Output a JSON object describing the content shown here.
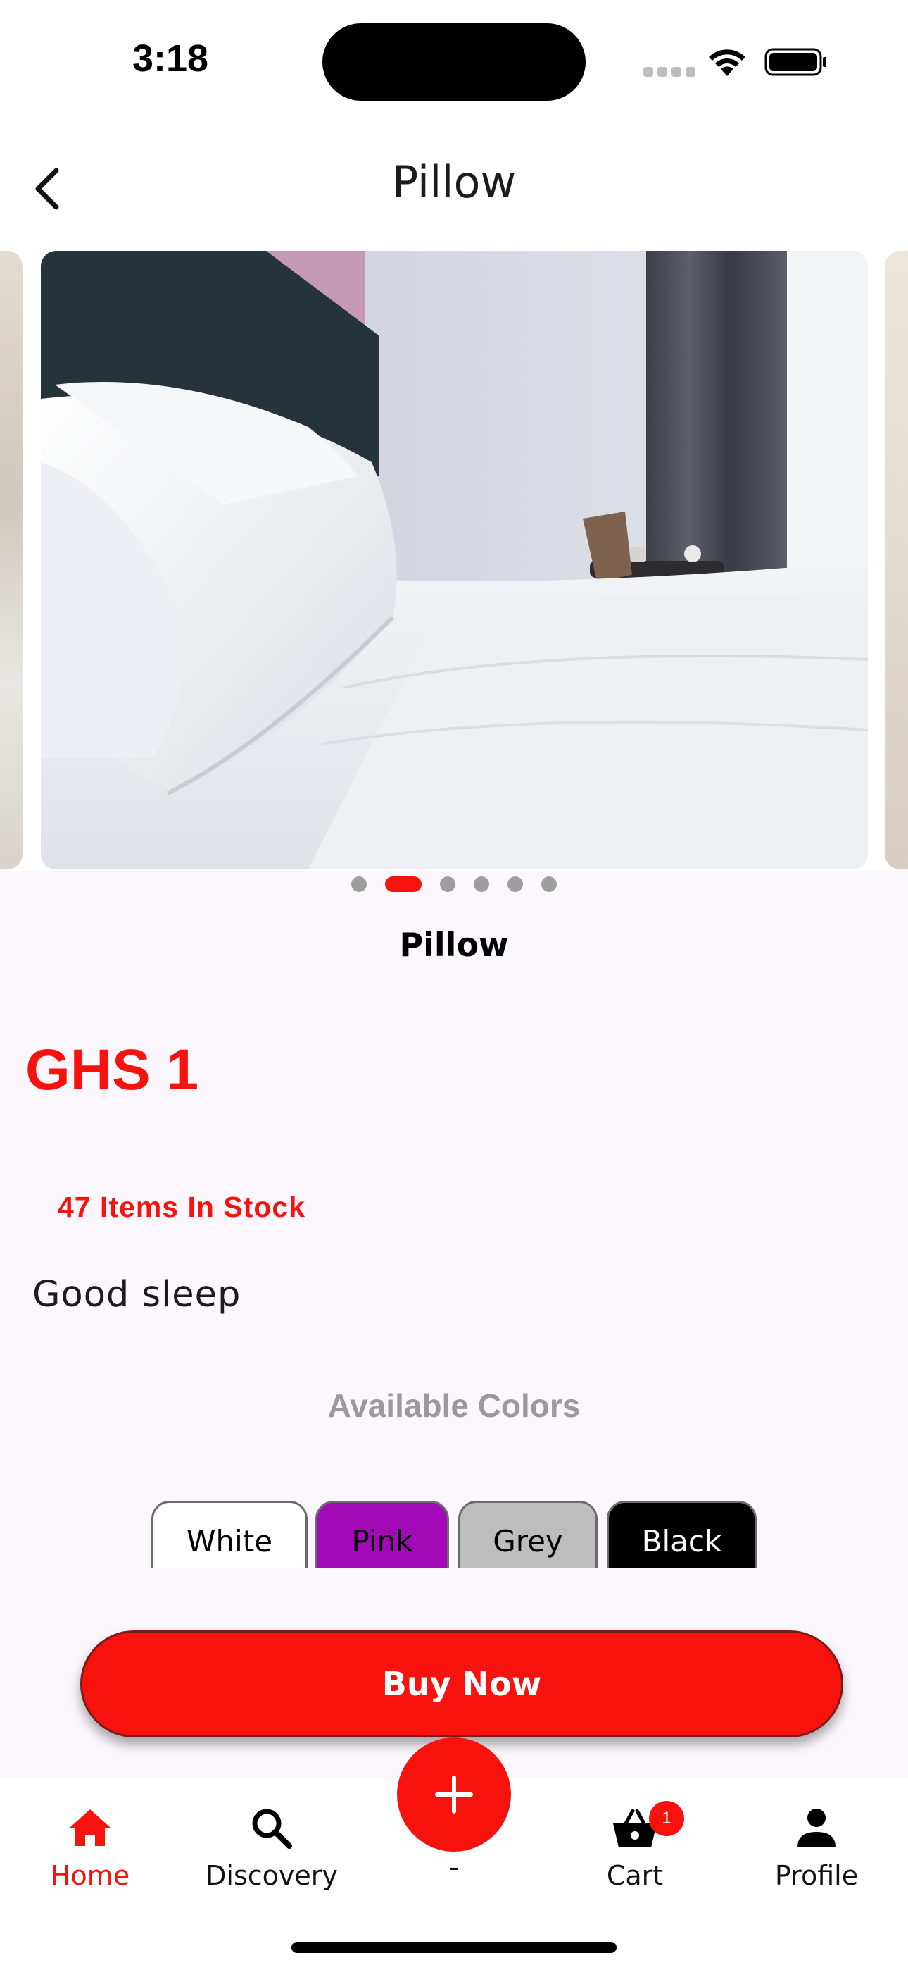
{
  "status_bar": {
    "time": "3:18"
  },
  "header": {
    "title": "Pillow"
  },
  "carousel": {
    "slide_count": 6,
    "active_index": 1
  },
  "product": {
    "name": "Pillow",
    "price": "GHS 1",
    "stock": "47 Items In Stock",
    "description": "Good sleep"
  },
  "colors": {
    "title": "Available Colors",
    "options": [
      "White",
      "Pink",
      "Grey",
      "Black"
    ],
    "swatches": [
      "#ffffff",
      "#a10ab6",
      "#bdbdbd",
      "#000000"
    ]
  },
  "actions": {
    "buy_label": "Buy Now"
  },
  "nav": {
    "items": [
      {
        "label": "Home",
        "icon": "home-icon",
        "active": true
      },
      {
        "label": "Discovery",
        "icon": "search-icon"
      },
      {
        "label": "-",
        "icon": "plus-icon"
      },
      {
        "label": "Cart",
        "icon": "cart-icon",
        "badge": "1"
      },
      {
        "label": "Profile",
        "icon": "profile-icon"
      }
    ]
  },
  "theme": {
    "accent": "#f8120e",
    "background": "#fcf7fc"
  }
}
